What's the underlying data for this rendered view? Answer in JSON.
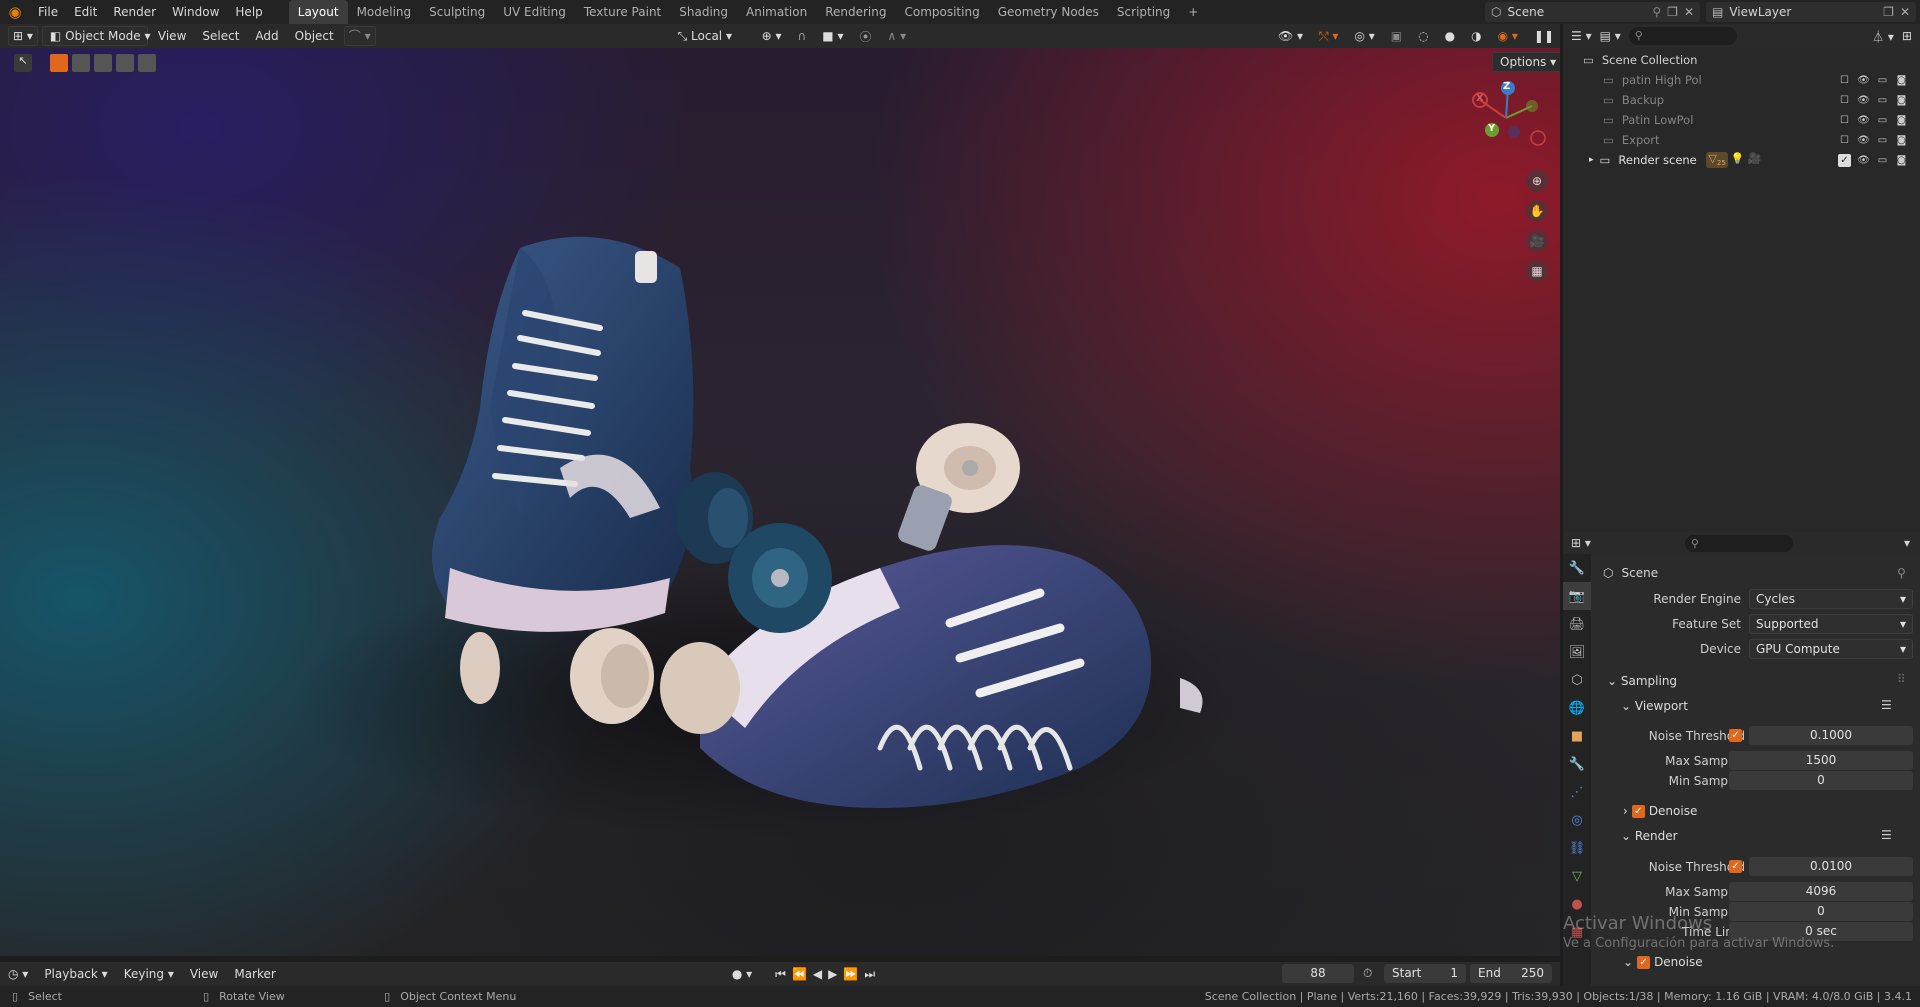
{
  "menu": {
    "items": [
      "File",
      "Edit",
      "Render",
      "Window",
      "Help"
    ],
    "workspaces": [
      "Layout",
      "Modeling",
      "Sculpting",
      "UV Editing",
      "Texture Paint",
      "Shading",
      "Animation",
      "Rendering",
      "Compositing",
      "Geometry Nodes",
      "Scripting"
    ],
    "active_workspace": "Layout",
    "add_tab": "+",
    "scene": "Scene",
    "view_layer": "ViewLayer"
  },
  "viewport_header": {
    "mode": "Object Mode",
    "menus": [
      "View",
      "Select",
      "Add",
      "Object"
    ],
    "transform_orientation": "Local",
    "options": "Options"
  },
  "gizmo": {
    "x": "X",
    "y": "Y",
    "z": "Z"
  },
  "outliner": {
    "root": "Scene Collection",
    "collections": [
      {
        "name": "patin  High Pol",
        "checked": false,
        "dim": true
      },
      {
        "name": "Backup",
        "checked": false,
        "dim": true
      },
      {
        "name": "Patin LowPol",
        "checked": false,
        "dim": true
      },
      {
        "name": "Export",
        "checked": false,
        "dim": true
      },
      {
        "name": "Render scene",
        "checked": true,
        "dim": false
      }
    ],
    "render_scene_badge": "25"
  },
  "properties": {
    "context": "Scene",
    "render_engine_label": "Render Engine",
    "render_engine": "Cycles",
    "feature_set_label": "Feature Set",
    "feature_set": "Supported",
    "device_label": "Device",
    "device": "GPU Compute",
    "sampling": "Sampling",
    "viewport": "Viewport",
    "vp_noise_label": "Noise Threshold",
    "vp_noise": "0.1000",
    "vp_max_label": "Max Samples",
    "vp_max": "1500",
    "vp_min_label": "Min Samples",
    "vp_min": "0",
    "vp_denoise": "Denoise",
    "render": "Render",
    "r_noise_label": "Noise Threshold",
    "r_noise": "0.0100",
    "r_max_label": "Max Samples",
    "r_max": "4096",
    "r_min_label": "Min Samples",
    "r_min": "0",
    "r_time_label": "Time Limit",
    "r_time": "0 sec",
    "r_denoise": "Denoise"
  },
  "watermark": {
    "line1": "Activar Windows",
    "line2": "Ve a Configuración para activar Windows."
  },
  "timeline": {
    "menus": [
      "Playback",
      "Keying",
      "View",
      "Marker"
    ],
    "current_frame": "88",
    "start_label": "Start",
    "start": "1",
    "end_label": "End",
    "end": "250"
  },
  "statusbar": {
    "select": "Select",
    "rotate": "Rotate View",
    "context_menu": "Object Context Menu",
    "info": "Scene Collection | Plane | Verts:21,160 | Faces:39,929 | Tris:39,930 | Objects:1/38 | Memory: 1.16 GiB | VRAM: 4.0/8.0 GiB | 3.4.1"
  },
  "colors": {
    "accent": "#e0681c",
    "active_tab": "#3d3d3d",
    "panel": "#2b2b2b",
    "header": "#232323"
  }
}
